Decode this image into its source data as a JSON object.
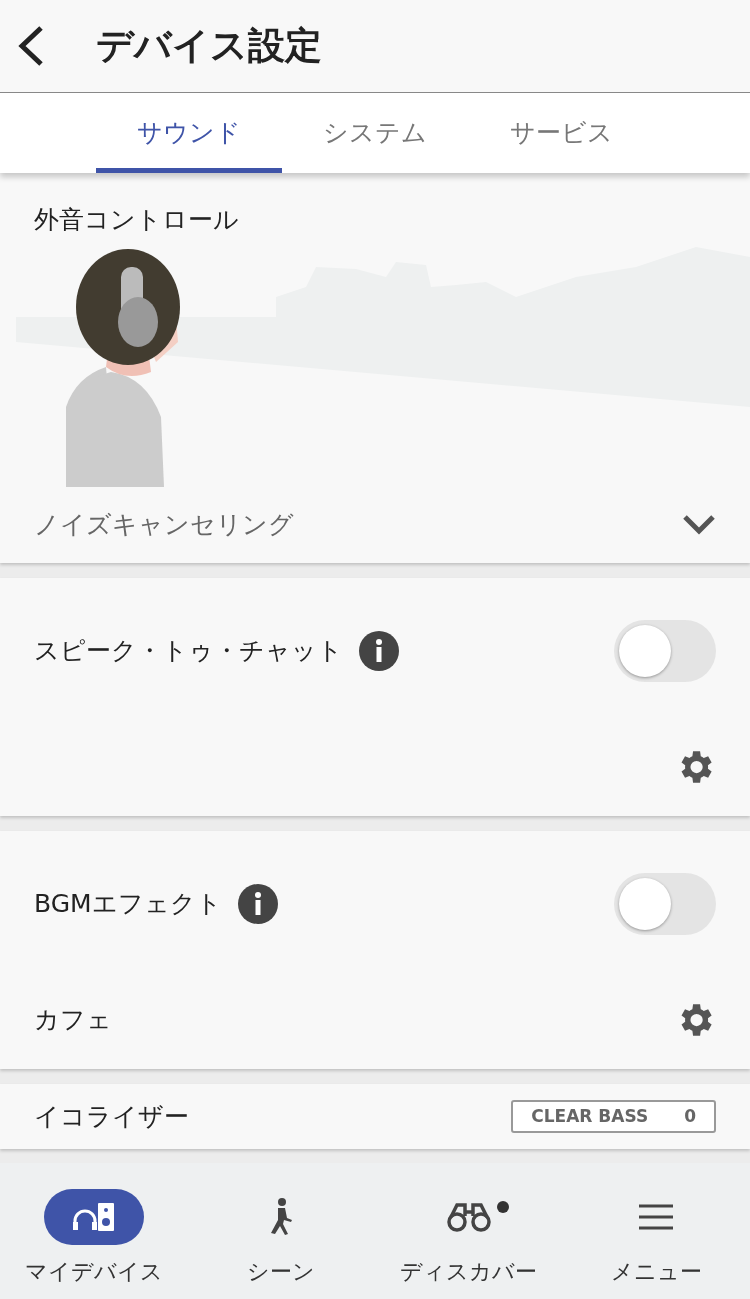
{
  "header": {
    "title": "デバイス設定"
  },
  "tabs": [
    {
      "label": "サウンド",
      "selected": true
    },
    {
      "label": "システム",
      "selected": false
    },
    {
      "label": "サービス",
      "selected": false
    }
  ],
  "ambient_sound_control": {
    "title": "外音コントロール",
    "mode": "ノイズキャンセリング",
    "expanded": false
  },
  "settings": [
    {
      "kind": "toggle",
      "label": "スピーク・トゥ・チャット",
      "on": false
    },
    {
      "kind": "toggle",
      "label": "BGMエフェクト",
      "on": false,
      "value": "カフェ"
    },
    {
      "kind": "equalizer",
      "label": "イコライザー",
      "preset": "CLEAR BASS",
      "preset_value": "0"
    }
  ],
  "bottom_nav": [
    {
      "label": "マイデバイス",
      "selected": true,
      "badge": false
    },
    {
      "label": "シーン",
      "selected": false,
      "badge": false
    },
    {
      "label": "ディスカバー",
      "selected": false,
      "badge": true
    },
    {
      "label": "メニュー",
      "selected": false,
      "badge": false
    }
  ]
}
